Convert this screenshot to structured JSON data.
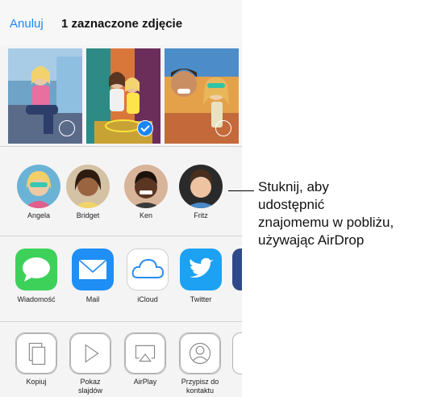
{
  "header": {
    "cancel_label": "Anuluj",
    "title": "1 zaznaczone zdjęcie"
  },
  "photos": [
    {
      "selected": false
    },
    {
      "selected": true
    },
    {
      "selected": false
    }
  ],
  "airdrop_contacts": [
    {
      "name": "Angela"
    },
    {
      "name": "Bridget"
    },
    {
      "name": "Ken"
    },
    {
      "name": "Fritz"
    }
  ],
  "share_apps": [
    {
      "label": "Wiadomość",
      "icon": "messages-icon",
      "color": "#3dd15a"
    },
    {
      "label": "Mail",
      "icon": "mail-icon",
      "color": "#1f8ef5"
    },
    {
      "label": "iCloud",
      "icon": "icloud-icon",
      "color": "#ffffff"
    },
    {
      "label": "Twitter",
      "icon": "twitter-icon",
      "color": "#1da1f2"
    }
  ],
  "actions": [
    {
      "label_lines": [
        "Kopiuj"
      ],
      "icon": "copy-icon"
    },
    {
      "label_lines": [
        "Pokaz",
        "slajdów"
      ],
      "icon": "slideshow-icon"
    },
    {
      "label_lines": [
        "AirPlay"
      ],
      "icon": "airplay-icon"
    },
    {
      "label_lines": [
        "Przypisz do",
        "kontaktu"
      ],
      "icon": "assign-contact-icon"
    }
  ],
  "callout": {
    "lines": [
      "Stuknij, aby",
      "udostępnić",
      "znajomemu w pobliżu,",
      "używając AirDrop"
    ]
  },
  "colors": {
    "accent": "#1a86f5",
    "sheet_background": "#f4f4f4"
  }
}
